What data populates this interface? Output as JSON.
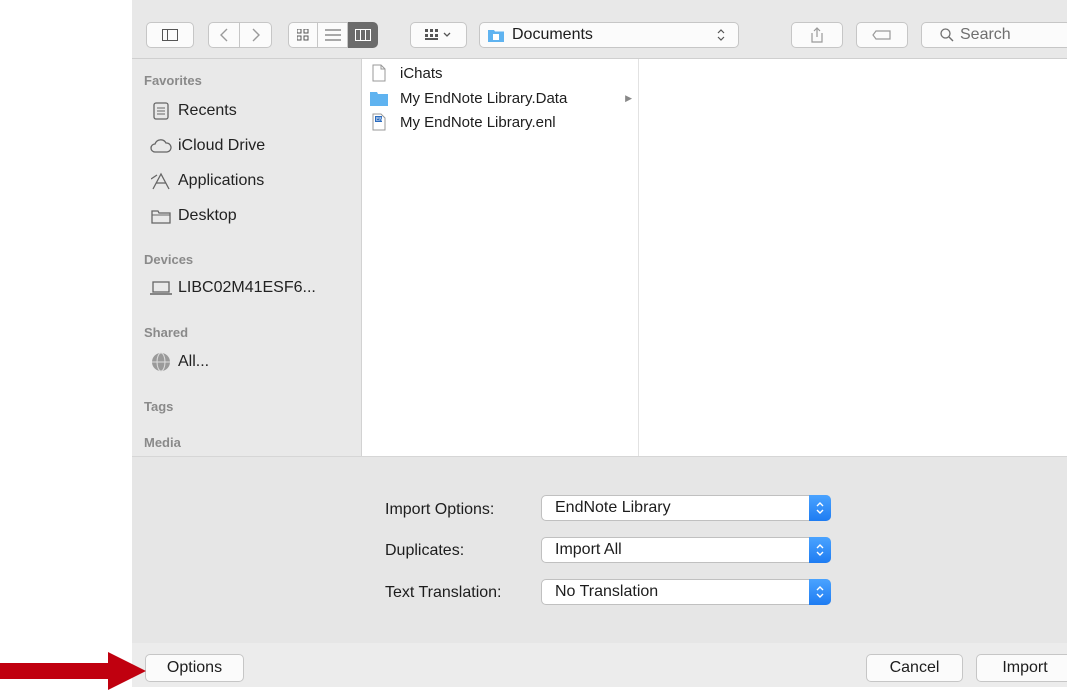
{
  "toolbar": {
    "location": "Documents",
    "search_placeholder": "Search"
  },
  "sidebar": {
    "sections": {
      "favorites": "Favorites",
      "devices": "Devices",
      "shared": "Shared",
      "tags": "Tags",
      "media": "Media"
    },
    "favorites": [
      "Recents",
      "iCloud Drive",
      "Applications",
      "Desktop"
    ],
    "devices": [
      "LIBC02M41ESF6..."
    ],
    "shared": [
      "All..."
    ]
  },
  "files": [
    {
      "name": "iChats",
      "icon": "document-icon"
    },
    {
      "name": "My EndNote Library.Data",
      "icon": "folder-icon"
    },
    {
      "name": "My EndNote Library.enl",
      "icon": "endnote-file-icon"
    }
  ],
  "options": {
    "import_options_label": "Import Options:",
    "import_options_value": "EndNote Library",
    "duplicates_label": "Duplicates:",
    "duplicates_value": "Import All",
    "text_translation_label": "Text Translation:",
    "text_translation_value": "No Translation"
  },
  "buttons": {
    "options": "Options",
    "cancel": "Cancel",
    "import": "Import"
  },
  "colors": {
    "accent": "#1e7cf2",
    "folder": "#5fb3f0",
    "arrow": "#c0000f"
  }
}
